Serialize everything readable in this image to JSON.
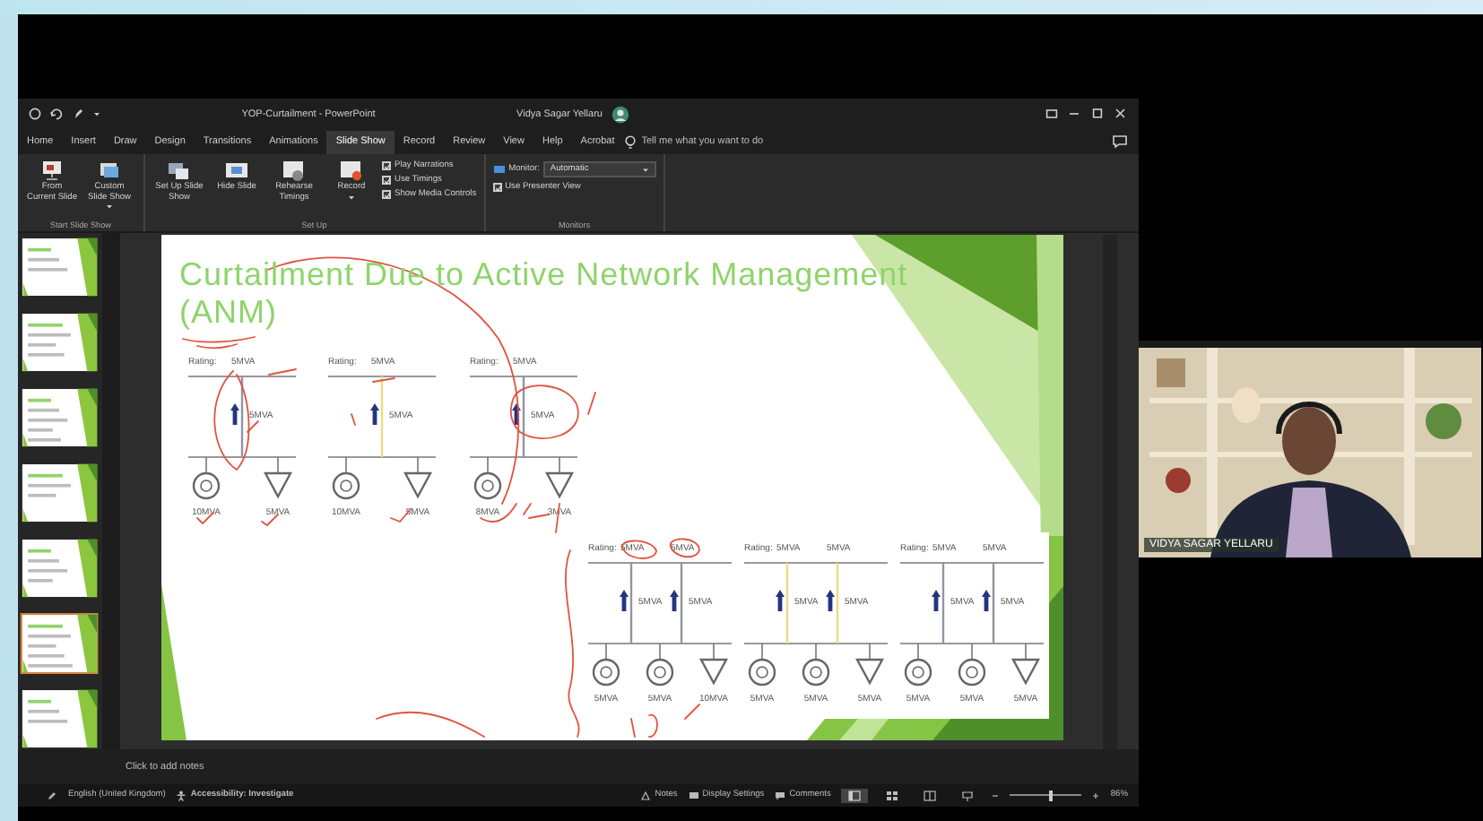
{
  "window": {
    "title": "YOP-Curtailment  -  PowerPoint",
    "user": "Vidya Sagar Yellaru"
  },
  "tabs": [
    {
      "label": "Home",
      "selected": false
    },
    {
      "label": "Insert",
      "selected": false
    },
    {
      "label": "Draw",
      "selected": false
    },
    {
      "label": "Design",
      "selected": false
    },
    {
      "label": "Transitions",
      "selected": false
    },
    {
      "label": "Animations",
      "selected": false
    },
    {
      "label": "Slide Show",
      "selected": true
    },
    {
      "label": "Record",
      "selected": false
    },
    {
      "label": "Review",
      "selected": false
    },
    {
      "label": "View",
      "selected": false
    },
    {
      "label": "Help",
      "selected": false
    },
    {
      "label": "Acrobat",
      "selected": false
    }
  ],
  "tell_me": {
    "placeholder": "Tell me what you want to do"
  },
  "ribbon": {
    "groups": [
      {
        "label": "Start Slide Show",
        "items": [
          {
            "kind": "from-current",
            "label": "From Current Slide",
            "dropdown": false
          },
          {
            "kind": "custom-show",
            "label": "Custom Slide Show",
            "dropdown": true
          }
        ]
      },
      {
        "label": "Set Up",
        "items": [
          {
            "kind": "setup",
            "label": "Set Up Slide Show",
            "dropdown": false
          },
          {
            "kind": "hide",
            "label": "Hide Slide",
            "dropdown": false
          },
          {
            "kind": "rehearse",
            "label": "Rehearse Timings",
            "dropdown": false
          },
          {
            "kind": "record",
            "label": "Record",
            "dropdown": true
          },
          {
            "kind": "checkbox",
            "label": "Play Narrations",
            "checked": true
          },
          {
            "kind": "checkbox",
            "label": "Use Timings",
            "checked": true
          },
          {
            "kind": "checkbox",
            "label": "Show Media Controls",
            "checked": true
          }
        ]
      },
      {
        "label": "Monitors",
        "items": [
          {
            "kind": "select",
            "label": "Monitor:",
            "value": "Automatic"
          },
          {
            "kind": "checkbox",
            "label": "Use Presenter View",
            "checked": true
          }
        ]
      }
    ]
  },
  "thumbnails": [
    {
      "selected": false
    },
    {
      "selected": false
    },
    {
      "selected": false
    },
    {
      "selected": false
    },
    {
      "selected": false
    },
    {
      "selected": true
    },
    {
      "selected": false
    }
  ],
  "slide": {
    "title": "Curtailment Due to Active Network Management (ANM)",
    "diagrams": [
      {
        "rating_label": "Rating:",
        "ratings": [
          "5MVA"
        ],
        "branches": [
          {
            "value": "5MVA",
            "color": "#8f96a3"
          }
        ],
        "nodes": [
          {
            "kind": "generator",
            "value": "10MVA"
          },
          {
            "kind": "load",
            "value": "5MVA"
          }
        ]
      },
      {
        "rating_label": "Rating:",
        "ratings": [
          "5MVA"
        ],
        "branches": [
          {
            "value": "5MVA",
            "color": "#ecdc84"
          }
        ],
        "nodes": [
          {
            "kind": "generator",
            "value": "10MVA"
          },
          {
            "kind": "load",
            "value": "5MVA"
          }
        ]
      },
      {
        "rating_label": "Rating:",
        "ratings": [
          "5MVA"
        ],
        "branches": [
          {
            "value": "5MVA",
            "color": "#8f96a3"
          }
        ],
        "nodes": [
          {
            "kind": "generator",
            "value": "8MVA"
          },
          {
            "kind": "load",
            "value": "3MVA"
          }
        ]
      },
      {
        "rating_label": "Rating:",
        "ratings": [
          "5MVA",
          "5MVA"
        ],
        "branches": [
          {
            "value": "5MVA",
            "color": "#8f96a3"
          },
          {
            "value": "5MVA",
            "color": "#8f96a3"
          }
        ],
        "nodes": [
          {
            "kind": "generator",
            "value": "5MVA"
          },
          {
            "kind": "generator",
            "value": "5MVA"
          },
          {
            "kind": "load",
            "value": "10MVA"
          }
        ]
      },
      {
        "rating_label": "Rating:",
        "ratings": [
          "5MVA",
          "5MVA"
        ],
        "branches": [
          {
            "value": "5MVA",
            "color": "#ecdc84"
          },
          {
            "value": "5MVA",
            "color": "#ecdc84"
          }
        ],
        "nodes": [
          {
            "kind": "generator",
            "value": "5MVA"
          },
          {
            "kind": "generator",
            "value": "5MVA"
          },
          {
            "kind": "load",
            "value": "5MVA"
          }
        ]
      },
      {
        "rating_label": "Rating:",
        "ratings": [
          "5MVA",
          "5MVA"
        ],
        "branches": [
          {
            "value": "5MVA",
            "color": "#8f96a3"
          },
          {
            "value": "5MVA",
            "color": "#8f96a3"
          }
        ],
        "nodes": [
          {
            "kind": "generator",
            "value": "5MVA"
          },
          {
            "kind": "generator",
            "value": "5MVA"
          },
          {
            "kind": "load",
            "value": "5MVA"
          }
        ]
      }
    ]
  },
  "notes": {
    "placeholder": "Click to add notes"
  },
  "status_bar": {
    "language": "English (United Kingdom)",
    "accessibility": "Accessibility: Investigate",
    "buttons": [
      {
        "kind": "notes",
        "label": "Notes"
      },
      {
        "kind": "display",
        "label": "Display Settings"
      },
      {
        "kind": "comments",
        "label": "Comments"
      }
    ],
    "views": [
      {
        "kind": "normal",
        "selected": true
      },
      {
        "kind": "sorter",
        "selected": false
      },
      {
        "kind": "reading",
        "selected": false
      },
      {
        "kind": "slideshow",
        "selected": false
      }
    ],
    "zoom": {
      "level": 0.55,
      "reading": "86%"
    }
  },
  "participant": {
    "name": "VIDYA SAGAR YELLARU"
  }
}
